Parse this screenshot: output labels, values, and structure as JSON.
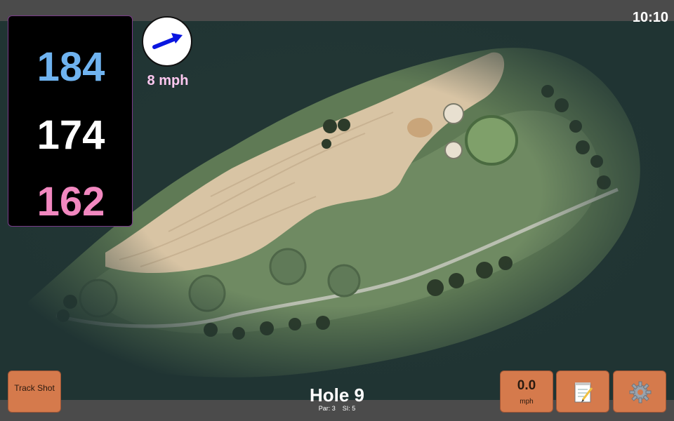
{
  "status": {
    "time": "10:10"
  },
  "distances": {
    "back": "184",
    "middle": "174",
    "front": "162"
  },
  "wind": {
    "speed_label": "8 mph",
    "direction_icon": "arrow-icon",
    "colors": {
      "arrow": "#0a16e0",
      "label": "#ffc8f0"
    }
  },
  "hole": {
    "title": "Hole 9",
    "par_label": "Par: 3",
    "si_label": "SI: 5"
  },
  "buttons": {
    "track_shot": "Track Shot",
    "speed_value": "0.0",
    "speed_unit": "mph",
    "notes_icon": "notepad-icon",
    "settings_icon": "gear-icon"
  },
  "colors": {
    "button": "#d57a4c",
    "back_dist": "#6fb3f0",
    "front_dist": "#f288c0",
    "panel": "#000000"
  }
}
